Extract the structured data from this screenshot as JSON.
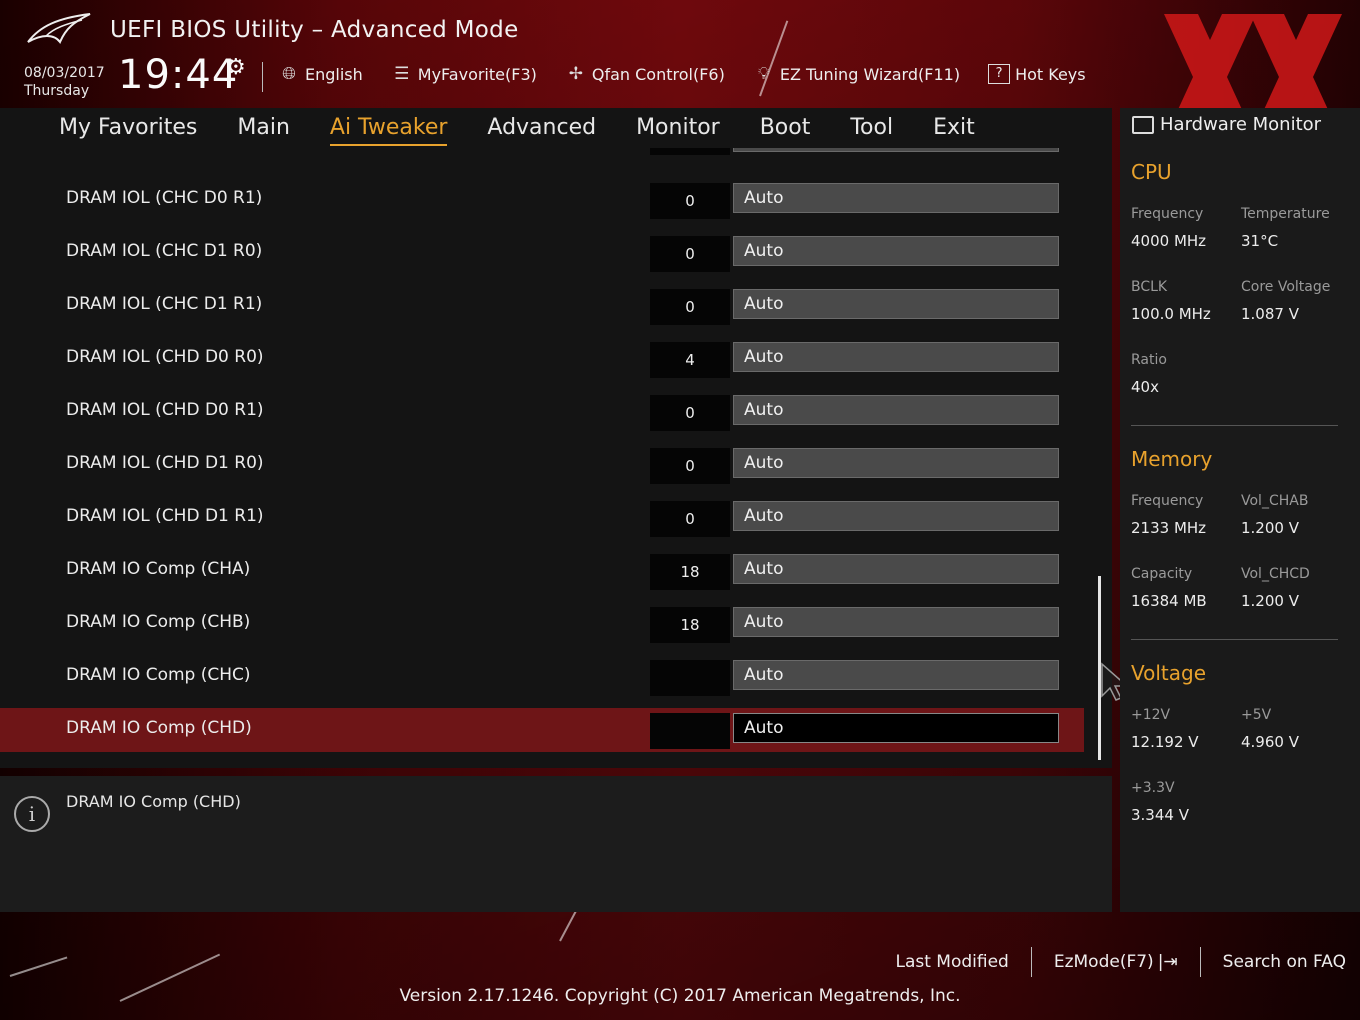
{
  "header": {
    "title": "UEFI BIOS Utility – Advanced Mode",
    "date": "08/03/2017",
    "day": "Thursday",
    "time": "19:44",
    "toolbar": [
      {
        "label": "English",
        "icon": "globe-icon"
      },
      {
        "label": "MyFavorite(F3)",
        "icon": "favorite-list-icon"
      },
      {
        "label": "Qfan Control(F6)",
        "icon": "fan-icon"
      },
      {
        "label": "EZ Tuning Wizard(F11)",
        "icon": "lightbulb-icon"
      },
      {
        "label": "Hot Keys",
        "icon": "hotkeys-icon"
      }
    ]
  },
  "nav": {
    "tabs": [
      "My Favorites",
      "Main",
      "Ai Tweaker",
      "Advanced",
      "Monitor",
      "Boot",
      "Tool",
      "Exit"
    ],
    "active": "Ai Tweaker"
  },
  "settings": [
    {
      "label": "DRAM IOL (CHC D0 R1)",
      "value": "0",
      "setting": "Auto"
    },
    {
      "label": "DRAM IOL (CHC D1 R0)",
      "value": "0",
      "setting": "Auto"
    },
    {
      "label": "DRAM IOL (CHC D1 R1)",
      "value": "0",
      "setting": "Auto"
    },
    {
      "label": "DRAM IOL (CHD D0 R0)",
      "value": "4",
      "setting": "Auto"
    },
    {
      "label": "DRAM IOL (CHD D0 R1)",
      "value": "0",
      "setting": "Auto"
    },
    {
      "label": "DRAM IOL (CHD D1 R0)",
      "value": "0",
      "setting": "Auto"
    },
    {
      "label": "DRAM IOL (CHD D1 R1)",
      "value": "0",
      "setting": "Auto"
    },
    {
      "label": "DRAM IO Comp (CHA)",
      "value": "18",
      "setting": "Auto"
    },
    {
      "label": "DRAM IO Comp (CHB)",
      "value": "18",
      "setting": "Auto"
    },
    {
      "label": "DRAM IO Comp (CHC)",
      "value": "",
      "setting": "Auto"
    },
    {
      "label": "DRAM IO Comp (CHD)",
      "value": "",
      "setting": "Auto"
    }
  ],
  "help": {
    "text": "DRAM IO Comp (CHD)"
  },
  "hw_monitor": {
    "title": "Hardware Monitor",
    "cpu": {
      "heading": "CPU",
      "frequency_label": "Frequency",
      "frequency": "4000 MHz",
      "temperature_label": "Temperature",
      "temperature": "31°C",
      "bclk_label": "BCLK",
      "bclk": "100.0 MHz",
      "core_voltage_label": "Core Voltage",
      "core_voltage": "1.087 V",
      "ratio_label": "Ratio",
      "ratio": "40x"
    },
    "memory": {
      "heading": "Memory",
      "frequency_label": "Frequency",
      "frequency": "2133 MHz",
      "vol_chab_label": "Vol_CHAB",
      "vol_chab": "1.200 V",
      "capacity_label": "Capacity",
      "capacity": "16384 MB",
      "vol_chcd_label": "Vol_CHCD",
      "vol_chcd": "1.200 V"
    },
    "voltage": {
      "heading": "Voltage",
      "v12_label": "+12V",
      "v12": "12.192 V",
      "v5_label": "+5V",
      "v5": "4.960 V",
      "v33_label": "+3.3V",
      "v33": "3.344 V"
    }
  },
  "footer": {
    "last_modified": "Last Modified",
    "ezmode": "EzMode(F7)",
    "search_faq": "Search on FAQ",
    "version": "Version 2.17.1246. Copyright (C) 2017 American Megatrends, Inc."
  },
  "colors": {
    "accent": "#e8a22d",
    "selected_row": "#6e1517",
    "brand_red": "#7a0a0e"
  }
}
